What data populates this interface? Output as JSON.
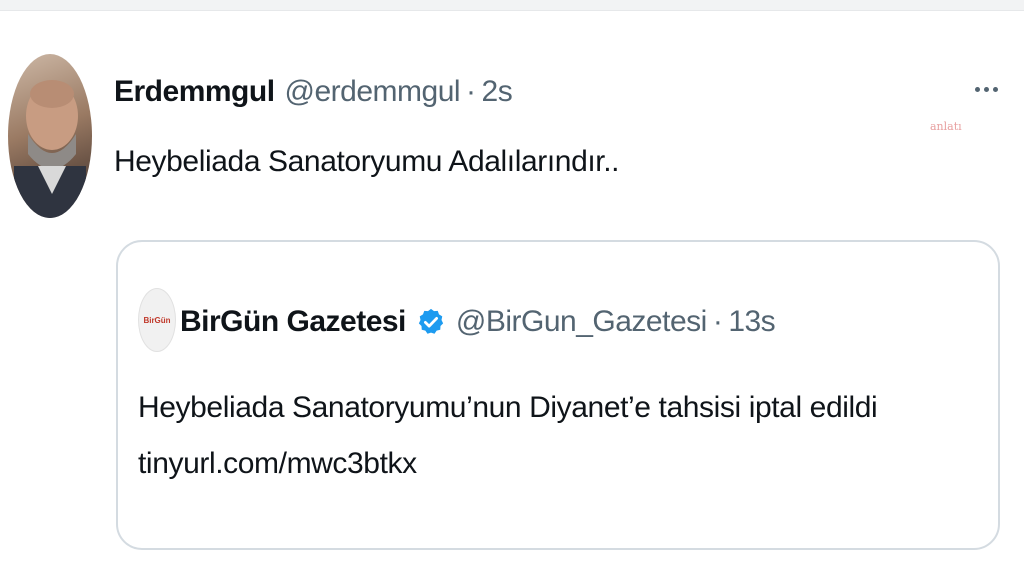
{
  "tweet": {
    "author_name": "Erdemmgul",
    "author_handle": "@erdemmgul",
    "separator": "·",
    "time": "2s",
    "text": "Heybeliada Sanatoryumu Adalılarındır..",
    "more_icon": "more-horizontal-icon"
  },
  "quote": {
    "author_name": "BirGün Gazetesi",
    "verified_icon": "verified-badge-icon",
    "author_handle": "@BirGun_Gazetesi",
    "separator": "·",
    "time": "13s",
    "text": "Heybeliada Sanatoryumu’nun Diyanet’e tahsisi iptal edildi",
    "link": "tinyurl.com/mwc3btkx",
    "avatar_text": "BirGün"
  },
  "watermark": "anlatı",
  "colors": {
    "text_primary": "#0f1419",
    "text_secondary": "#536471",
    "verified": "#1d9bf0",
    "card_border": "#d4dbe1"
  }
}
